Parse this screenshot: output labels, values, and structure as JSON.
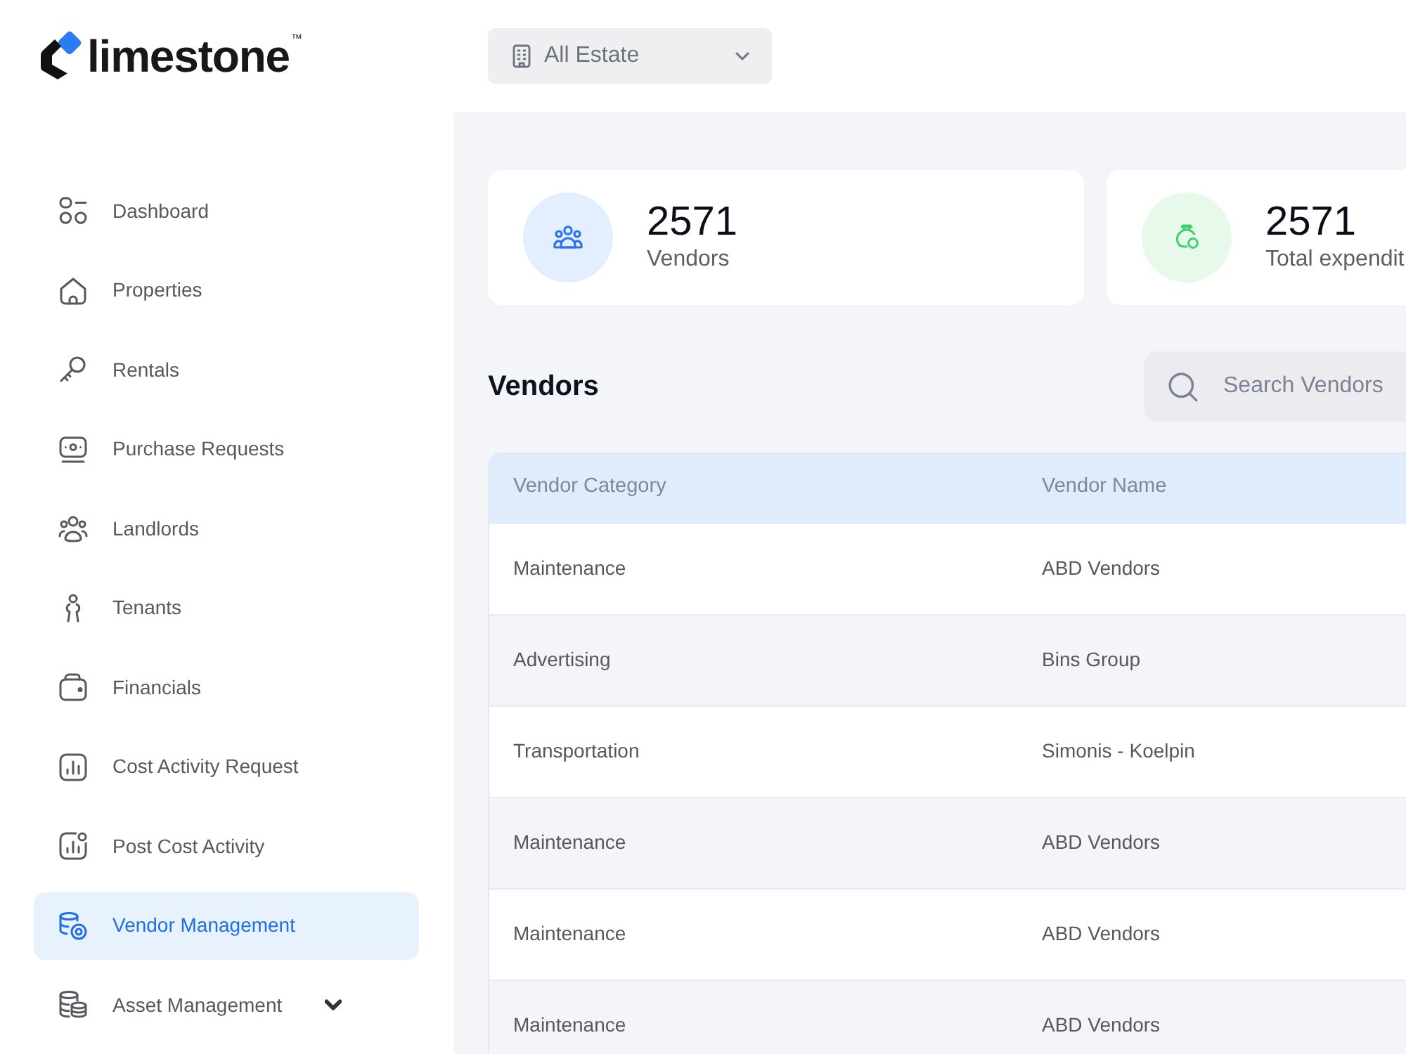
{
  "logo": {
    "text": "limestone",
    "mark": "™"
  },
  "estate_selector": {
    "value": "All Estate"
  },
  "sidebar": {
    "items": [
      {
        "kind": "link",
        "label": "Dashboard",
        "selected": false
      },
      {
        "kind": "link",
        "label": "Properties",
        "selected": false
      },
      {
        "kind": "link",
        "label": "Rentals",
        "selected": false
      },
      {
        "kind": "link",
        "label": "Purchase Requests",
        "selected": false
      },
      {
        "kind": "link",
        "label": "Landlords",
        "selected": false
      },
      {
        "kind": "link",
        "label": "Tenants",
        "selected": false
      },
      {
        "kind": "link",
        "label": "Financials",
        "selected": false
      },
      {
        "kind": "link",
        "label": "Cost Activity Request",
        "selected": false
      },
      {
        "kind": "link",
        "label": "Post Cost Activity",
        "selected": false
      },
      {
        "kind": "link",
        "label": "Vendor Management",
        "selected": true
      },
      {
        "kind": "group",
        "label": "Asset Management",
        "selected": false,
        "expanded": false
      }
    ]
  },
  "stats": [
    {
      "kind": "vendors",
      "value": "2571",
      "label": "Vendors"
    },
    {
      "kind": "expenditure",
      "value": "2571",
      "label": "Total expendit"
    }
  ],
  "vendors_section": {
    "title": "Vendors",
    "search": {
      "placeholder": "Search Vendors"
    }
  },
  "table": {
    "columns": [
      "Vendor Category",
      "Vendor Name"
    ],
    "rows": [
      [
        "Maintenance",
        "ABD Vendors"
      ],
      [
        "Advertising",
        "Bins Group"
      ],
      [
        "Transportation",
        "Simonis - Koelpin"
      ],
      [
        "Maintenance",
        "ABD Vendors"
      ],
      [
        "Maintenance",
        "ABD Vendors"
      ],
      [
        "Maintenance",
        "ABD Vendors"
      ]
    ]
  }
}
